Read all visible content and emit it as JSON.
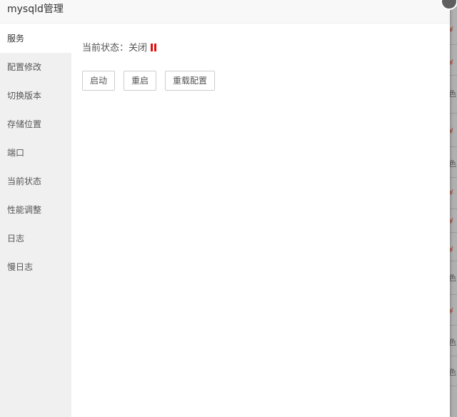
{
  "window": {
    "title": "mysqld管理"
  },
  "sidebar": {
    "items": [
      {
        "label": "服务",
        "active": true
      },
      {
        "label": "配置修改"
      },
      {
        "label": "切换版本"
      },
      {
        "label": "存储位置"
      },
      {
        "label": "端口"
      },
      {
        "label": "当前状态"
      },
      {
        "label": "性能调整"
      },
      {
        "label": "日志"
      },
      {
        "label": "慢日志"
      }
    ]
  },
  "service": {
    "status_label": "当前状态：",
    "status_value": "关闭",
    "status_color": "#e20f0f",
    "status_icon": "pause-icon",
    "buttons": {
      "start": "启动",
      "restart": "重启",
      "reload": "重载配置"
    }
  },
  "background": {
    "marks": [
      "¥",
      "¥",
      "色",
      "¥",
      "色",
      "¥",
      "¥",
      "¥",
      "色",
      "¥",
      "色",
      "色"
    ]
  }
}
